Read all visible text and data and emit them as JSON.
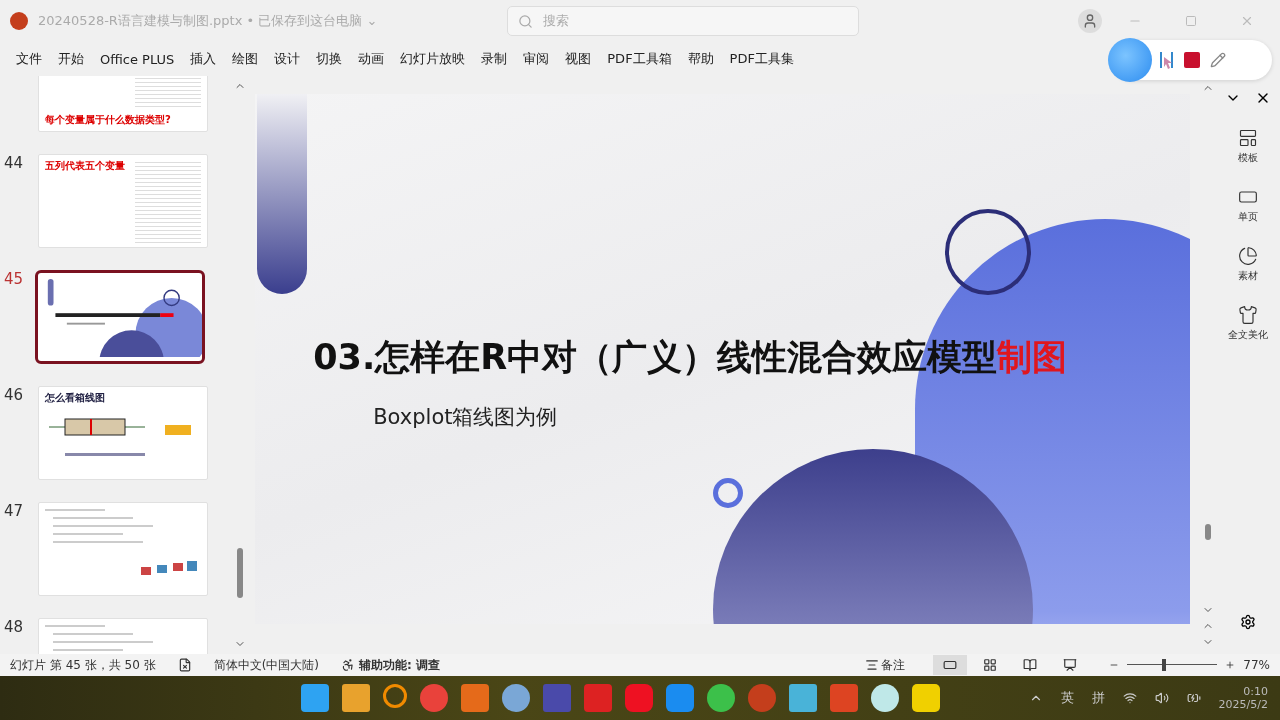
{
  "window": {
    "title": "20240528-R语言建模与制图.pptx • 已保存到这台电脑 ⌄",
    "search_placeholder": "搜索"
  },
  "ribbon_tabs": [
    "文件",
    "开始",
    "Office PLUS",
    "插入",
    "绘图",
    "设计",
    "切换",
    "动画",
    "幻灯片放映",
    "录制",
    "审阅",
    "视图",
    "PDF工具箱",
    "帮助",
    "PDF工具集"
  ],
  "thumbnails": [
    {
      "kind": "question",
      "selected": false,
      "title": "每个变量属于什么数据类型?"
    },
    {
      "number": "44",
      "kind": "table",
      "selected": false,
      "title": "五列代表五个变量"
    },
    {
      "number": "45",
      "kind": "cover",
      "selected": true
    },
    {
      "number": "46",
      "kind": "boxplot",
      "selected": false,
      "title": "怎么看箱线图"
    },
    {
      "number": "47",
      "kind": "code",
      "selected": false
    },
    {
      "number": "48",
      "kind": "code",
      "selected": false
    }
  ],
  "slide": {
    "title": "03.怎样在R中对（广义）线性混合效应模型",
    "title_highlight": "制图",
    "subtitle": "Boxplot箱线图为例"
  },
  "side_panel": [
    {
      "kind": "template",
      "label": "模板"
    },
    {
      "kind": "single",
      "label": "单页"
    },
    {
      "kind": "asset",
      "label": "素材"
    },
    {
      "kind": "beautify",
      "label": "全文美化"
    }
  ],
  "status_bar": {
    "slide_info": "幻灯片 第 45 张，共 50 张",
    "language": "简体中文(中国大陆)",
    "accessibility": "辅助功能: 调查",
    "notes": "备注",
    "views": [
      {
        "kind": "normal",
        "selected": true
      },
      {
        "kind": "sorter",
        "selected": false
      },
      {
        "kind": "reading",
        "selected": false
      },
      {
        "kind": "show",
        "selected": false
      }
    ],
    "zoom": {
      "level": 0.38,
      "reading": "77%"
    }
  },
  "taskbar": {
    "apps": [
      {
        "kind": "windows"
      },
      {
        "kind": "blocks"
      },
      {
        "kind": "search"
      },
      {
        "kind": "chrome"
      },
      {
        "kind": "matlab"
      },
      {
        "kind": "r"
      },
      {
        "kind": "grid"
      },
      {
        "kind": "zotero"
      },
      {
        "kind": "music"
      },
      {
        "kind": "star"
      },
      {
        "kind": "wechat"
      },
      {
        "kind": "powerpoint"
      },
      {
        "kind": "notepad"
      },
      {
        "kind": "wps"
      },
      {
        "kind": "cloud"
      },
      {
        "kind": "player"
      }
    ],
    "tray": [
      "英",
      "拼"
    ],
    "time": "0:10",
    "date": "2025/5/2"
  }
}
